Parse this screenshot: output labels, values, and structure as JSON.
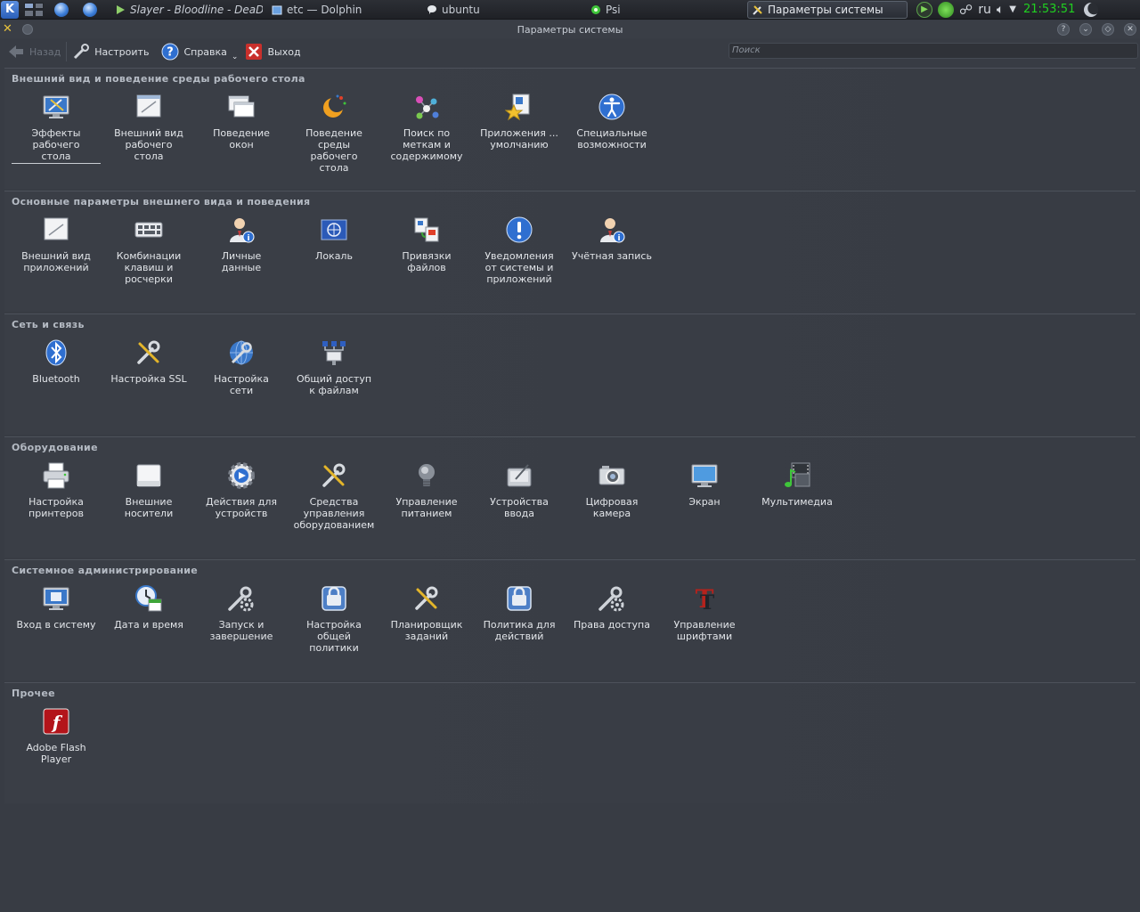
{
  "taskbar": {
    "tasks": [
      {
        "label": "Slayer - Bloodline - DeaDB",
        "icon": "play-icon"
      },
      {
        "label": "etc — Dolphin",
        "icon": "folder-icon"
      },
      {
        "label": "ubuntu",
        "icon": "chat-bubble-icon"
      },
      {
        "label": "Psi",
        "icon": "psi-flower-icon"
      }
    ],
    "active_task": "Параметры системы",
    "lang": "ru",
    "clock": "21:53:51"
  },
  "window": {
    "title": "Параметры системы"
  },
  "toolbar": {
    "back_label": "Назад",
    "configure_label": "Настроить",
    "help_label": "Справка",
    "quit_label": "Выход",
    "search_placeholder": "Поиск"
  },
  "groups": [
    {
      "title": "Внешний вид и поведение среды рабочего стола",
      "items": [
        {
          "label": "Эффекты\nрабочего\nстола",
          "icon": "desktop-effects-icon"
        },
        {
          "label": "Внешний вид\nрабочего\nстола",
          "icon": "workspace-appearance-icon"
        },
        {
          "label": "Поведение\nокон",
          "icon": "window-behavior-icon"
        },
        {
          "label": "Поведение\nсреды\nрабочего\nстола",
          "icon": "workspace-behavior-icon"
        },
        {
          "label": "Поиск по\nметкам и\nсодержимому",
          "icon": "desktop-search-icon"
        },
        {
          "label": "Приложения ...\nумолчанию",
          "icon": "default-apps-icon"
        },
        {
          "label": "Специальные\nвозможности",
          "icon": "accessibility-icon"
        }
      ]
    },
    {
      "title": "Основные параметры внешнего вида и поведения",
      "items": [
        {
          "label": "Внешний вид\nприложений",
          "icon": "app-appearance-icon"
        },
        {
          "label": "Комбинации\nклавиш и\nросчерки",
          "icon": "shortcuts-icon"
        },
        {
          "label": "Личные\nданные",
          "icon": "personal-info-icon"
        },
        {
          "label": "Локаль",
          "icon": "locale-icon"
        },
        {
          "label": "Привязки\nфайлов",
          "icon": "file-associations-icon"
        },
        {
          "label": "Уведомления\nот системы и\nприложений",
          "icon": "notifications-icon"
        },
        {
          "label": "Учётная запись",
          "icon": "account-icon"
        }
      ]
    },
    {
      "title": "Сеть и связь",
      "items": [
        {
          "label": "Bluetooth",
          "icon": "bluetooth-icon"
        },
        {
          "label": "Настройка SSL",
          "icon": "ssl-icon"
        },
        {
          "label": "Настройка\nсети",
          "icon": "network-settings-icon"
        },
        {
          "label": "Общий доступ\nк файлам",
          "icon": "file-sharing-icon"
        }
      ]
    },
    {
      "title": "Оборудование",
      "items": [
        {
          "label": "Настройка\nпринтеров",
          "icon": "printer-icon"
        },
        {
          "label": "Внешние\nносители",
          "icon": "removable-storage-icon"
        },
        {
          "label": "Действия для\nустройств",
          "icon": "device-actions-icon"
        },
        {
          "label": "Средства\nуправления\nоборудованием",
          "icon": "hardware-tools-icon"
        },
        {
          "label": "Управление\nпитанием",
          "icon": "power-management-icon"
        },
        {
          "label": "Устройства\nввода",
          "icon": "input-devices-icon"
        },
        {
          "label": "Цифровая\nкамера",
          "icon": "camera-icon"
        },
        {
          "label": "Экран",
          "icon": "display-icon"
        },
        {
          "label": "Мультимедиа",
          "icon": "multimedia-icon"
        }
      ]
    },
    {
      "title": "Системное администрирование",
      "items": [
        {
          "label": "Вход в систему",
          "icon": "login-screen-icon"
        },
        {
          "label": "Дата и время",
          "icon": "date-time-icon"
        },
        {
          "label": "Запуск и\nзавершение",
          "icon": "startup-shutdown-icon"
        },
        {
          "label": "Настройка\nобщей\nполитики",
          "icon": "shared-policy-icon"
        },
        {
          "label": "Планировщик\nзаданий",
          "icon": "task-scheduler-icon"
        },
        {
          "label": "Политика для\nдействий",
          "icon": "action-policy-icon"
        },
        {
          "label": "Права доступа",
          "icon": "permissions-icon"
        },
        {
          "label": "Управление\nшрифтами",
          "icon": "font-management-icon"
        }
      ]
    },
    {
      "title": "Прочее",
      "items": [
        {
          "label": "Adobe Flash\nPlayer",
          "icon": "flash-player-icon"
        }
      ]
    }
  ]
}
